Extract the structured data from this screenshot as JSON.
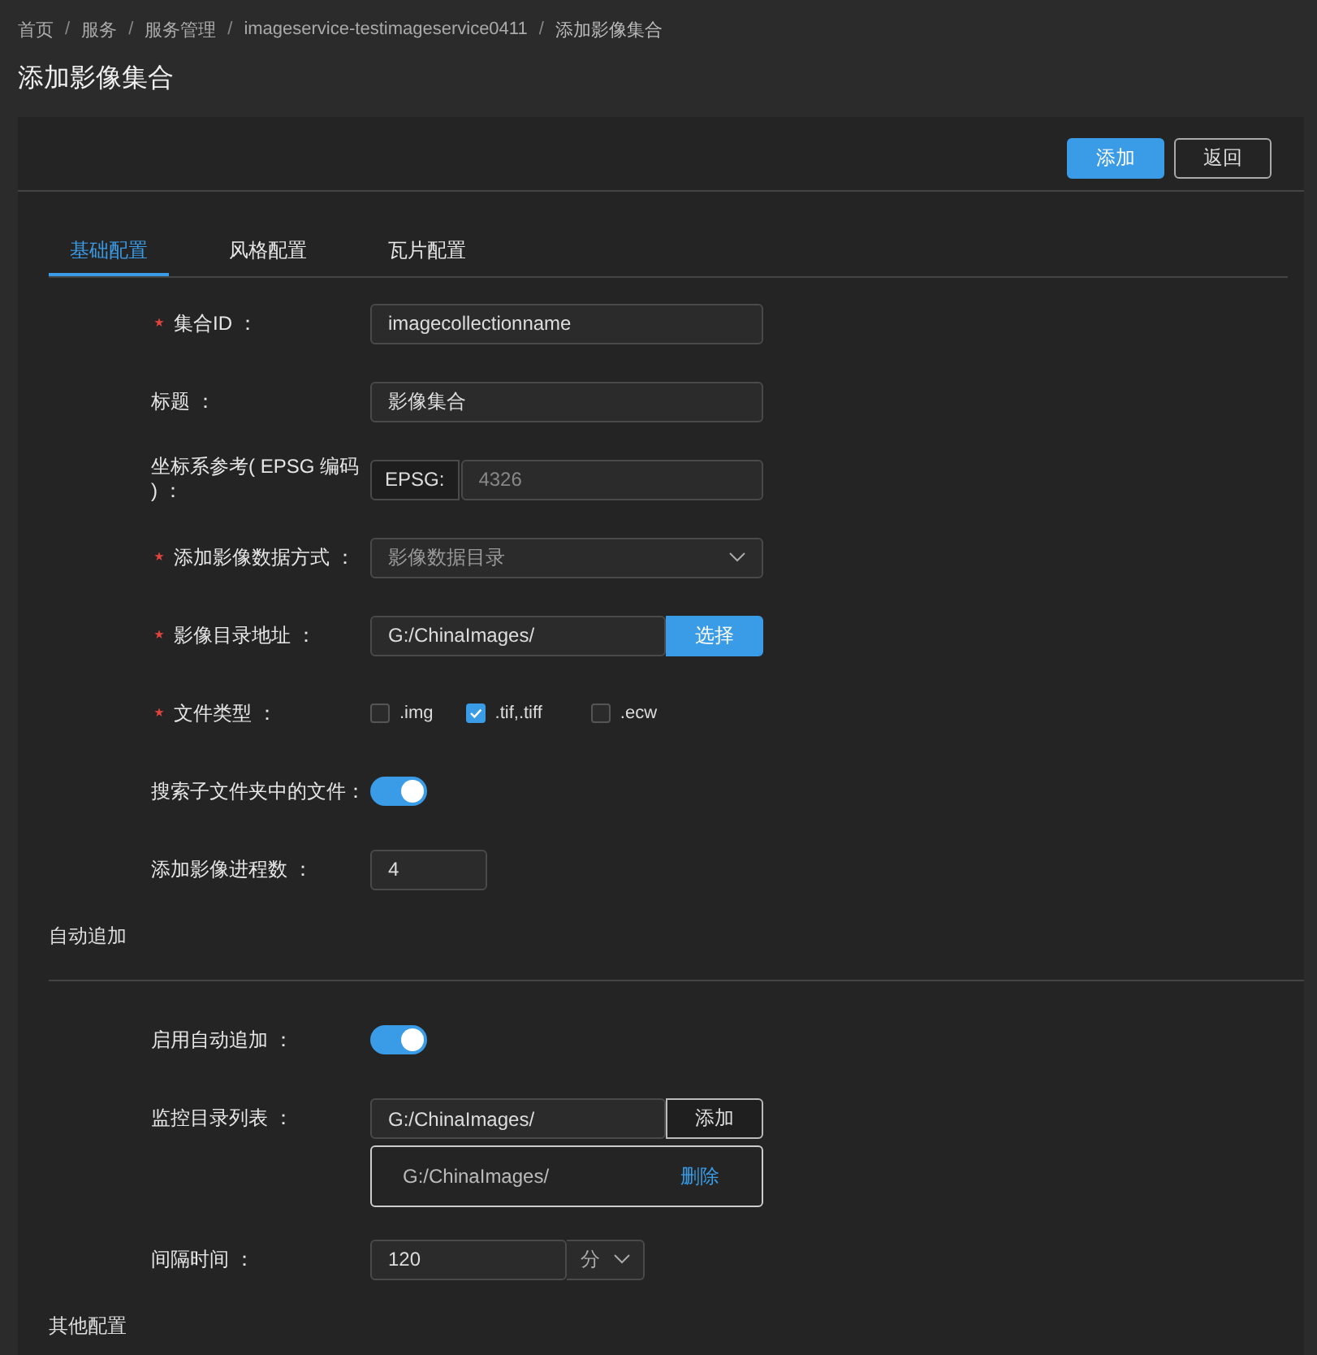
{
  "breadcrumb": [
    {
      "label": "首页"
    },
    {
      "label": "服务"
    },
    {
      "label": "服务管理"
    },
    {
      "label": "imageservice-testimageservice0411"
    },
    {
      "label": "添加影像集合"
    }
  ],
  "breadcrumb_separator": "/",
  "title": "添加影像集合",
  "actions": [
    {
      "label": "添加",
      "kind": "primary"
    },
    {
      "label": "返回",
      "kind": "default"
    }
  ],
  "tabs": [
    {
      "label": "基础配置",
      "selected": true
    },
    {
      "label": "风格配置",
      "selected": false
    },
    {
      "label": "瓦片配置",
      "selected": false
    }
  ],
  "sections": [
    {
      "fields": [
        {
          "kind": "text",
          "label": "集合ID ：",
          "required": true,
          "value": "imagecollectionname"
        },
        {
          "kind": "text",
          "label": "标题 ：",
          "required": false,
          "value": "影像集合"
        },
        {
          "kind": "addon",
          "label": "坐标系参考( EPSG 编码 ) ：",
          "required": false,
          "addon": "EPSG:",
          "placeholder": "4326"
        },
        {
          "kind": "select",
          "label": "添加影像数据方式 ：",
          "required": true,
          "placeholder": "影像数据目录"
        },
        {
          "kind": "browse",
          "label": "影像目录地址 ：",
          "required": true,
          "value": "G:/ChinaImages/",
          "button": "选择"
        },
        {
          "kind": "checkboxes",
          "label": "文件类型 ：",
          "required": true,
          "options": [
            {
              "label": ".img",
              "checked": false
            },
            {
              "label": ".tif,.tiff",
              "checked": true
            },
            {
              "label": ".ecw",
              "checked": false
            }
          ]
        },
        {
          "kind": "switch",
          "label": "搜索子文件夹中的文件：",
          "required": false,
          "on": true
        },
        {
          "kind": "number",
          "label": "添加影像进程数 ：",
          "required": false,
          "value": "4"
        }
      ]
    },
    {
      "heading": "自动追加",
      "fields": [
        {
          "kind": "switch",
          "label": "启用自动追加 ：",
          "required": false,
          "on": true
        },
        {
          "kind": "dirlist",
          "label": "监控目录列表 ：",
          "required": false,
          "value": "G:/ChinaImages/",
          "button": "添加",
          "items": [
            {
              "path": "G:/ChinaImages/",
              "action": "删除"
            }
          ]
        },
        {
          "kind": "unit",
          "label": "间隔时间 ：",
          "required": false,
          "value": "120",
          "unit": "分"
        }
      ]
    },
    {
      "heading": "其他配置"
    }
  ]
}
